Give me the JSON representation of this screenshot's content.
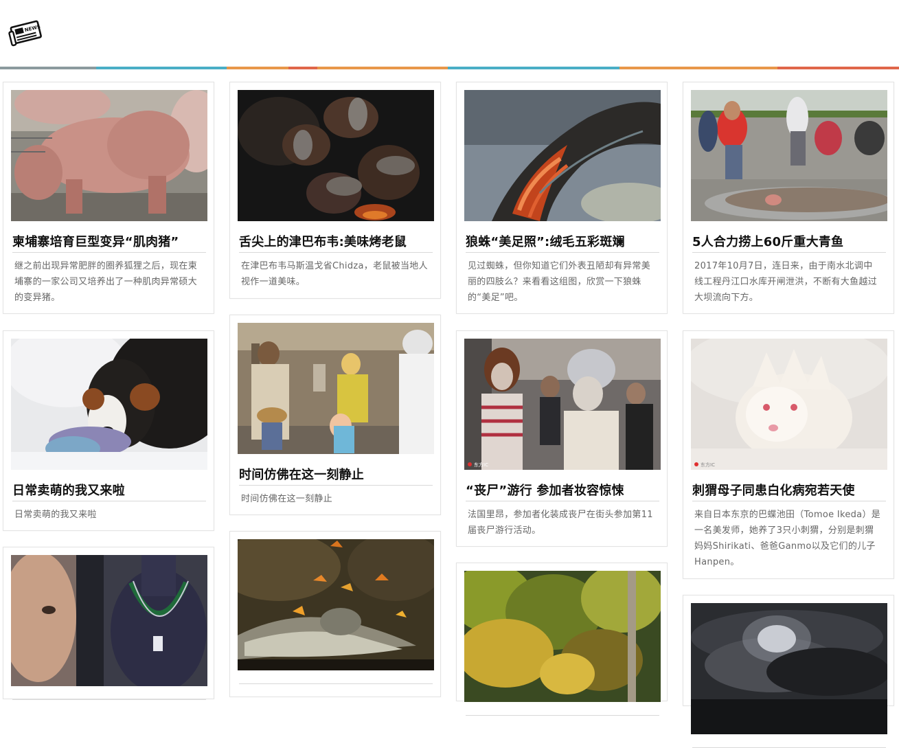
{
  "header": {
    "logo_text": "NEWS",
    "stripe_colors": [
      "#8c9a9e",
      "#4aaec6",
      "#e8974a",
      "#e0664a",
      "#4aaec6",
      "#e8974a",
      "#e0664a"
    ]
  },
  "cards": [
    {
      "title": "柬埔寨培育巨型变异“肌肉猪”",
      "desc": "继之前出现异常肥胖的圈养狐狸之后，现在柬埔寨的一家公司又培养出了一种肌肉异常硕大的变异猪。"
    },
    {
      "title": "舌尖上的津巴布韦:美味烤老鼠",
      "desc": "在津巴布韦马斯温戈省Chidza，老鼠被当地人视作一道美味。"
    },
    {
      "title": "狼蛛“美足照”:绒毛五彩斑斓",
      "desc": "见过蜘蛛，但你知道它们外表丑陋却有异常美丽的四肢么？来看看这组图，欣赏一下狼蛛的“美足”吧。"
    },
    {
      "title": "5人合力捞上60斤重大青鱼",
      "desc": "2017年10月7日，连日来，由于南水北调中线工程丹江口水库开闸泄洪，不断有大鱼越过大坝流向下方。"
    },
    {
      "title": "日常卖萌的我又来啦",
      "desc": "日常卖萌的我又来啦"
    },
    {
      "title": "时间仿佛在这一刻静止",
      "desc": "时间仿佛在这一刻静止"
    },
    {
      "title": "“丧尸”游行 参加者妆容惊悚",
      "desc": "法国里昂，参加者化装成丧尸在街头参加第11届丧尸游行活动。",
      "watermark": "东方IC"
    },
    {
      "title": "刺猬母子同患白化病宛若天使",
      "desc": "来自日本东京的巴蝶池田（Tomoe Ikeda）是一名美发师，她养了3只小刺猬，分别是刺猬妈妈Shirikati、爸爸Ganmo以及它们的儿子Hanpen。",
      "watermark": "东方IC"
    },
    {
      "title": "",
      "desc": ""
    },
    {
      "title": "",
      "desc": ""
    },
    {
      "title": "",
      "desc": ""
    },
    {
      "title": "",
      "desc": ""
    }
  ]
}
